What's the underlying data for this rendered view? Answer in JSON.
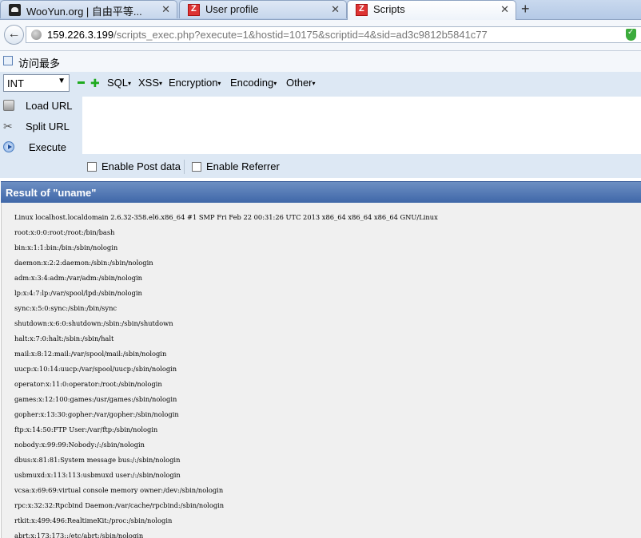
{
  "tabs": [
    {
      "label": "WooYun.org | 自由平等...",
      "icon": "wooyun-favicon"
    },
    {
      "label": "User profile",
      "icon": "red-z-favicon"
    },
    {
      "label": "Scripts",
      "icon": "red-z-favicon",
      "active": true
    }
  ],
  "new_tab_label": "+",
  "address": {
    "host": "159.226.3.199",
    "path": "/scripts_exec.php?execute=1&hostid=10175&scriptid=4&sid=ad3c9812b5841c77"
  },
  "bookmarks": [
    {
      "label": "访问最多",
      "icon": "bookmark-folder-icon"
    }
  ],
  "hackbar": {
    "select_value": "INT",
    "menus": [
      "SQL",
      "XSS",
      "Encryption",
      "Encoding",
      "Other"
    ],
    "buttons": [
      {
        "label": "Load URL",
        "icon": "load-url-icon"
      },
      {
        "label": "Split URL",
        "icon": "scissors-icon"
      },
      {
        "label": "Execute",
        "icon": "play-icon"
      }
    ],
    "post_label": "Enable Post data",
    "referrer_label": "Enable Referrer"
  },
  "result": {
    "title": "Result of \"uname\"",
    "lines": [
      "Linux localhost.localdomain 2.6.32-358.el6.x86_64 #1 SMP Fri Feb 22 00:31:26 UTC 2013 x86_64 x86_64 x86_64 GNU/Linux",
      "root:x:0:0:root:/root:/bin/bash",
      "bin:x:1:1:bin:/bin:/sbin/nologin",
      "daemon:x:2:2:daemon:/sbin:/sbin/nologin",
      "adm:x:3:4:adm:/var/adm:/sbin/nologin",
      "lp:x:4:7:lp:/var/spool/lpd:/sbin/nologin",
      "sync:x:5:0:sync:/sbin:/bin/sync",
      "shutdown:x:6:0:shutdown:/sbin:/sbin/shutdown",
      "halt:x:7:0:halt:/sbin:/sbin/halt",
      "mail:x:8:12:mail:/var/spool/mail:/sbin/nologin",
      "uucp:x:10:14:uucp:/var/spool/uucp:/sbin/nologin",
      "operator:x:11:0:operator:/root:/sbin/nologin",
      "games:x:12:100:games:/usr/games:/sbin/nologin",
      "gopher:x:13:30:gopher:/var/gopher:/sbin/nologin",
      "ftp:x:14:50:FTP User:/var/ftp:/sbin/nologin",
      "nobody:x:99:99:Nobody:/:/sbin/nologin",
      "dbus:x:81:81:System message bus:/:/sbin/nologin",
      "usbmuxd:x:113:113:usbmuxd user:/:/sbin/nologin",
      "vcsa:x:69:69:virtual console memory owner:/dev:/sbin/nologin",
      "rpc:x:32:32:Rpcbind Daemon:/var/cache/rpcbind:/sbin/nologin",
      "rtkit:x:499:496:RealtimeKit:/proc:/sbin/nologin",
      "abrt:x:173:173::/etc/abrt:/sbin/nologin"
    ]
  }
}
